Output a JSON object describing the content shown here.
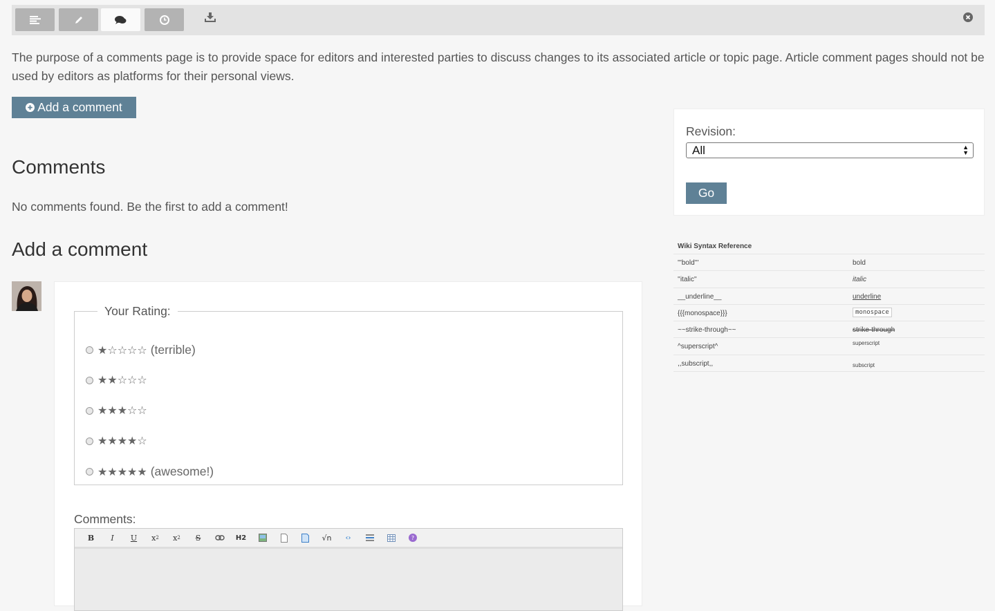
{
  "toolbar": {
    "tabs": [
      {
        "icon": "align-left-icon",
        "active": false
      },
      {
        "icon": "pencil-icon",
        "active": false
      },
      {
        "icon": "comments-icon",
        "active": true
      },
      {
        "icon": "clock-icon",
        "active": false
      }
    ],
    "download_icon": "download-icon",
    "close_icon": "close-circle-icon"
  },
  "intro_text": "The purpose of a comments page is to provide space for editors and interested parties to discuss changes to its associated article or topic page. Article comment pages should not be used by editors as platforms for their personal views.",
  "add_comment_button": "Add a comment",
  "comments_heading": "Comments",
  "no_comments_text": "No comments found. Be the first to add a comment!",
  "add_comment_heading": "Add a comment",
  "rating": {
    "legend": "Your Rating:",
    "options": [
      {
        "stars": "★☆☆☆☆",
        "label": "(terrible)"
      },
      {
        "stars": "★★☆☆☆",
        "label": ""
      },
      {
        "stars": "★★★☆☆",
        "label": ""
      },
      {
        "stars": "★★★★☆",
        "label": ""
      },
      {
        "stars": "★★★★★",
        "label": "(awesome!)"
      }
    ]
  },
  "comments_label": "Comments:",
  "editor_buttons": [
    "bold",
    "italic",
    "underline",
    "superscript",
    "subscript",
    "strikethrough",
    "link",
    "heading",
    "image",
    "page",
    "document",
    "math",
    "code",
    "horizontal-rule",
    "table",
    "help"
  ],
  "revision": {
    "label": "Revision:",
    "selected": "All",
    "go_label": "Go"
  },
  "wiki_reference": {
    "title": "Wiki Syntax Reference",
    "rows": [
      {
        "syntax": "'''bold'''",
        "result": "bold"
      },
      {
        "syntax": "''italic''",
        "result": "italic"
      },
      {
        "syntax": "__underline__",
        "result": "underline"
      },
      {
        "syntax": "{{{monospace}}}",
        "result": "monospace"
      },
      {
        "syntax": "~~strike-through~~",
        "result": "strike-through"
      },
      {
        "syntax": "^superscript^",
        "result": "superscript"
      },
      {
        "syntax": ",,subscript,,",
        "result": "subscript"
      }
    ]
  }
}
